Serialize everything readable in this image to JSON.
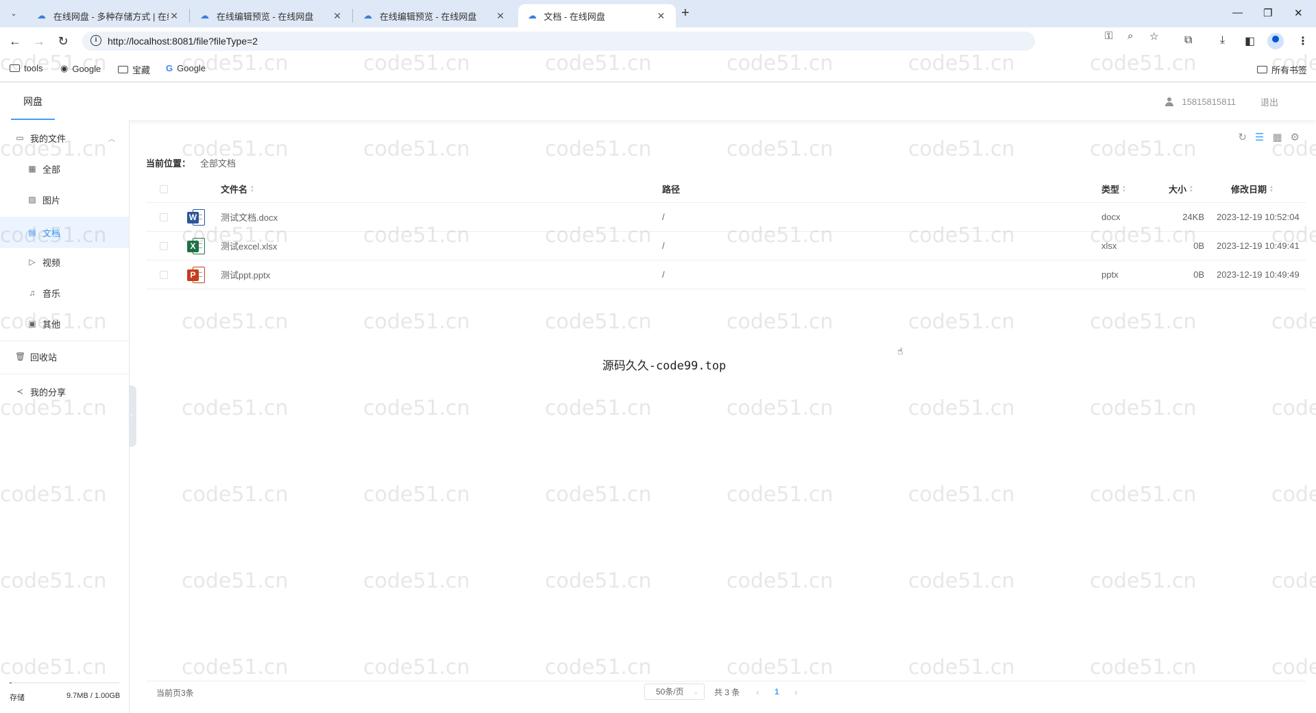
{
  "browser": {
    "tabs": [
      {
        "title": "在线网盘 - 多种存储方式 | 在线",
        "active": false
      },
      {
        "title": "在线编辑预览 - 在线网盘",
        "active": false
      },
      {
        "title": "在线编辑预览 - 在线网盘",
        "active": false
      },
      {
        "title": "文档 - 在线网盘",
        "active": true
      }
    ],
    "url": "http://localhost:8081/file?fileType=2",
    "bookmarks": [
      {
        "label": "tools",
        "icon": "folder-icon"
      },
      {
        "label": "Google",
        "icon": "globe-icon"
      },
      {
        "label": "宝藏",
        "icon": "folder-icon"
      },
      {
        "label": "Google",
        "icon": "google-g-icon"
      }
    ],
    "all_bookmarks": "所有书签"
  },
  "header": {
    "menu_item": "网盘",
    "user_phone": "15815815811",
    "logout": "退出"
  },
  "sidebar": {
    "my_files": "我的文件",
    "items": [
      {
        "label": "全部",
        "icon": "grid-icon"
      },
      {
        "label": "图片",
        "icon": "image-icon"
      },
      {
        "label": "文档",
        "icon": "document-icon",
        "active": true
      },
      {
        "label": "视频",
        "icon": "video-icon"
      },
      {
        "label": "音乐",
        "icon": "headphones-icon"
      },
      {
        "label": "其他",
        "icon": "box-icon"
      }
    ],
    "recycle": "回收站",
    "share": "我的分享",
    "storage_label": "存储",
    "storage_value": "9.7MB / 1.00GB",
    "storage_used_fraction": 0.0095
  },
  "main": {
    "crumb_label": "当前位置：",
    "crumb_item": "全部文档",
    "columns": {
      "name": "文件名",
      "path": "路径",
      "type": "类型",
      "size": "大小",
      "date": "修改日期"
    },
    "files": [
      {
        "name": "测试文档.docx",
        "path": "/",
        "type": "docx",
        "size": "24KB",
        "date": "2023-12-19 10:52:04",
        "kind": "word",
        "badge": "W"
      },
      {
        "name": "测试excel.xlsx",
        "path": "/",
        "type": "xlsx",
        "size": "0B",
        "date": "2023-12-19 10:49:41",
        "kind": "excel",
        "badge": "X"
      },
      {
        "name": "测试ppt.pptx",
        "path": "/",
        "type": "pptx",
        "size": "0B",
        "date": "2023-12-19 10:49:49",
        "kind": "ppt",
        "badge": "P"
      }
    ],
    "center_note": "源码久久-code99.top"
  },
  "pagination": {
    "current_count": "当前页3条",
    "page_size": "50条/页",
    "total": "共 3 条",
    "page": "1"
  },
  "watermark": "code51.cn"
}
